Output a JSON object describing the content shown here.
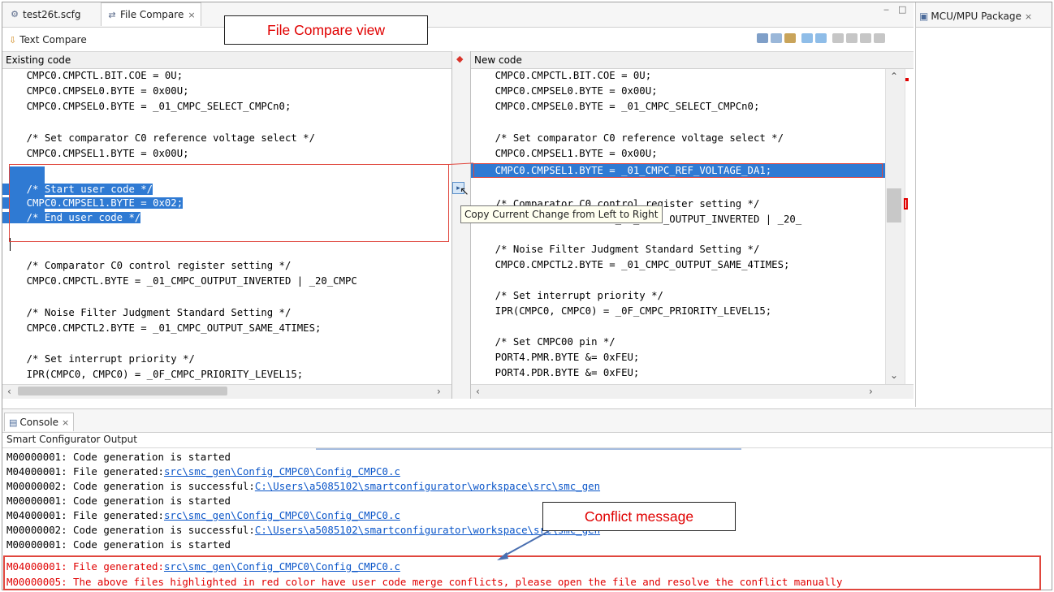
{
  "tabs": [
    {
      "label": "test26t.scfg",
      "active": false
    },
    {
      "label": "File Compare",
      "active": true,
      "close": "×"
    }
  ],
  "right_panel": {
    "title": "MCU/MPU Package",
    "close": "×"
  },
  "window_controls": {
    "minimize": "‒",
    "maximize": "□"
  },
  "compare_toolbar": {
    "label": "Text Compare"
  },
  "left_pane": {
    "header": "Existing code",
    "lines": [
      "    CMPC0.CMPCTL.BIT.COE = 0U;",
      "    CMPC0.CMPSEL0.BYTE = 0x00U;",
      "    CMPC0.CMPSEL0.BYTE = _01_CMPC_SELECT_CMPCn0;",
      "",
      "    /* Set comparator C0 reference voltage select */",
      "    CMPC0.CMPSEL1.BYTE = 0x00U;",
      "",
      "    /* Start user code */",
      "    CMPC0.CMPSEL1.BYTE = 0x02;",
      "    /* End user code */",
      "",
      "",
      "",
      "    /* Comparator C0 control register setting */",
      "    CMPC0.CMPCTL.BYTE = _01_CMPC_OUTPUT_INVERTED | _20_CMPC",
      "",
      "    /* Noise Filter Judgment Standard Setting */",
      "    CMPC0.CMPCTL2.BYTE = _01_CMPC_OUTPUT_SAME_4TIMES;",
      "",
      "    /* Set interrupt priority */",
      "    IPR(CMPC0, CMPC0) = _0F_CMPC_PRIORITY_LEVEL15;"
    ]
  },
  "right_pane": {
    "header": "New code",
    "lines": [
      "    CMPC0.CMPCTL.BIT.COE = 0U;",
      "    CMPC0.CMPSEL0.BYTE = 0x00U;",
      "    CMPC0.CMPSEL0.BYTE = _01_CMPC_SELECT_CMPCn0;",
      "",
      "    /* Set comparator C0 reference voltage select */",
      "    CMPC0.CMPSEL1.BYTE = 0x00U;",
      "    CMPC0.CMPSEL1.BYTE = _01_CMPC_REF_VOLTAGE_DA1;",
      "",
      "    /* Comparator C0 control register setting */",
      "    CMPC0.CMPCTL.BYTE = _01_CMPC_OUTPUT_INVERTED | _20_",
      "",
      "    /* Noise Filter Judgment Standard Setting */",
      "    CMPC0.CMPCTL2.BYTE = _01_CMPC_OUTPUT_SAME_4TIMES;",
      "",
      "    /* Set interrupt priority */",
      "    IPR(CMPC0, CMPC0) = _0F_CMPC_PRIORITY_LEVEL15;",
      "",
      "    /* Set CMPC00 pin */",
      "    PORT4.PMR.BYTE &= 0xFEU;",
      "    PORT4.PDR.BYTE &= 0xFEU;"
    ]
  },
  "tooltip": "Copy Current Change from Left to Right",
  "annotations": {
    "file_compare_view": "File Compare view",
    "conflict_message": "Conflict message"
  },
  "console": {
    "tab": "Console",
    "close": "×",
    "subtitle": "Smart Configurator Output",
    "lines": [
      {
        "prefix": "M00000001: Code generation is started",
        "link": "",
        "red": false
      },
      {
        "prefix": "M04000001: File generated:",
        "link": "src\\smc_gen\\Config_CMPC0\\Config_CMPC0.c",
        "red": false
      },
      {
        "prefix": "M00000002: Code generation is successful:",
        "link": "C:\\Users\\a5085102\\smartconfigurator\\workspace\\src\\smc_gen",
        "red": false
      },
      {
        "prefix": "M00000001: Code generation is started",
        "link": "",
        "red": false
      },
      {
        "prefix": "M04000001: File generated:",
        "link": "src\\smc_gen\\Config_CMPC0\\Config_CMPC0.c",
        "red": false
      },
      {
        "prefix": "M00000002: Code generation is successful:",
        "link": "C:\\Users\\a5085102\\smartconfigurator\\workspace\\src\\smc_gen",
        "red": false
      },
      {
        "prefix": "M00000001: Code generation is started",
        "link": "",
        "red": false
      },
      {
        "prefix": "M04000001: File generated:",
        "link": "src\\smc_gen\\Config_CMPC0\\Config_CMPC0.c",
        "red": true
      },
      {
        "prefix": "M00000005: The above files highlighted in red color have user code merge conflicts, please open the file and resolve the conflict manually",
        "link": "",
        "red": true
      }
    ]
  },
  "colors": {
    "accent_red": "#e00000",
    "selection_blue": "#2f7ad3",
    "link_blue": "#0b56c9"
  }
}
